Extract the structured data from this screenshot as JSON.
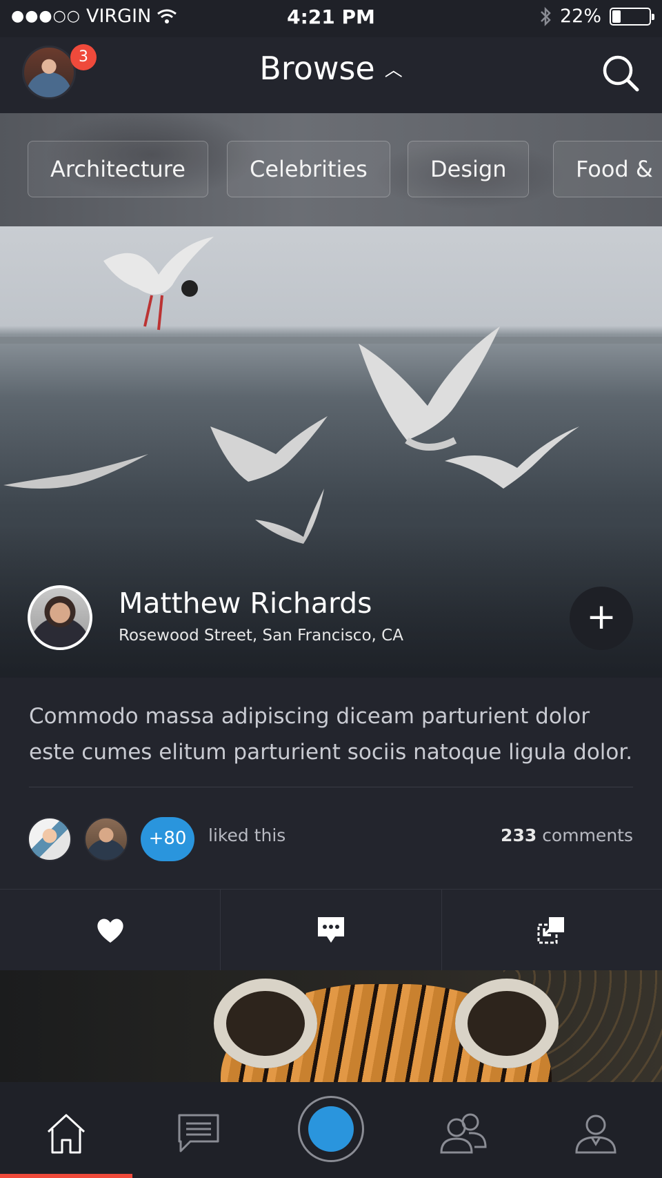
{
  "status_bar": {
    "signal_dots": "●●●○○",
    "carrier": "VIRGIN",
    "time": "4:21 PM",
    "battery_text": "22%",
    "battery_level": 0.22
  },
  "header": {
    "title": "Browse",
    "notification_count": "3"
  },
  "categories": [
    {
      "label": "Architecture"
    },
    {
      "label": "Celebrities"
    },
    {
      "label": "Design"
    },
    {
      "label": "Food & D"
    }
  ],
  "post": {
    "author_name": "Matthew Richards",
    "author_location": "Rosewood Street, San Francisco, CA",
    "add_label": "+",
    "body": "Commodo massa adipiscing diceam parturient dolor este cumes elitum parturient sociis natoque ligula dolor.",
    "likes_more": "+80",
    "liked_text": "liked this",
    "comments_count": "233",
    "comments_label": "comments"
  },
  "colors": {
    "accent_red": "#ef4a3b",
    "accent_blue": "#2a95dd",
    "background": "#23252d"
  },
  "tabs": [
    {
      "icon": "home-icon"
    },
    {
      "icon": "chat-icon"
    },
    {
      "icon": "camera-icon"
    },
    {
      "icon": "people-icon"
    },
    {
      "icon": "profile-icon"
    }
  ]
}
